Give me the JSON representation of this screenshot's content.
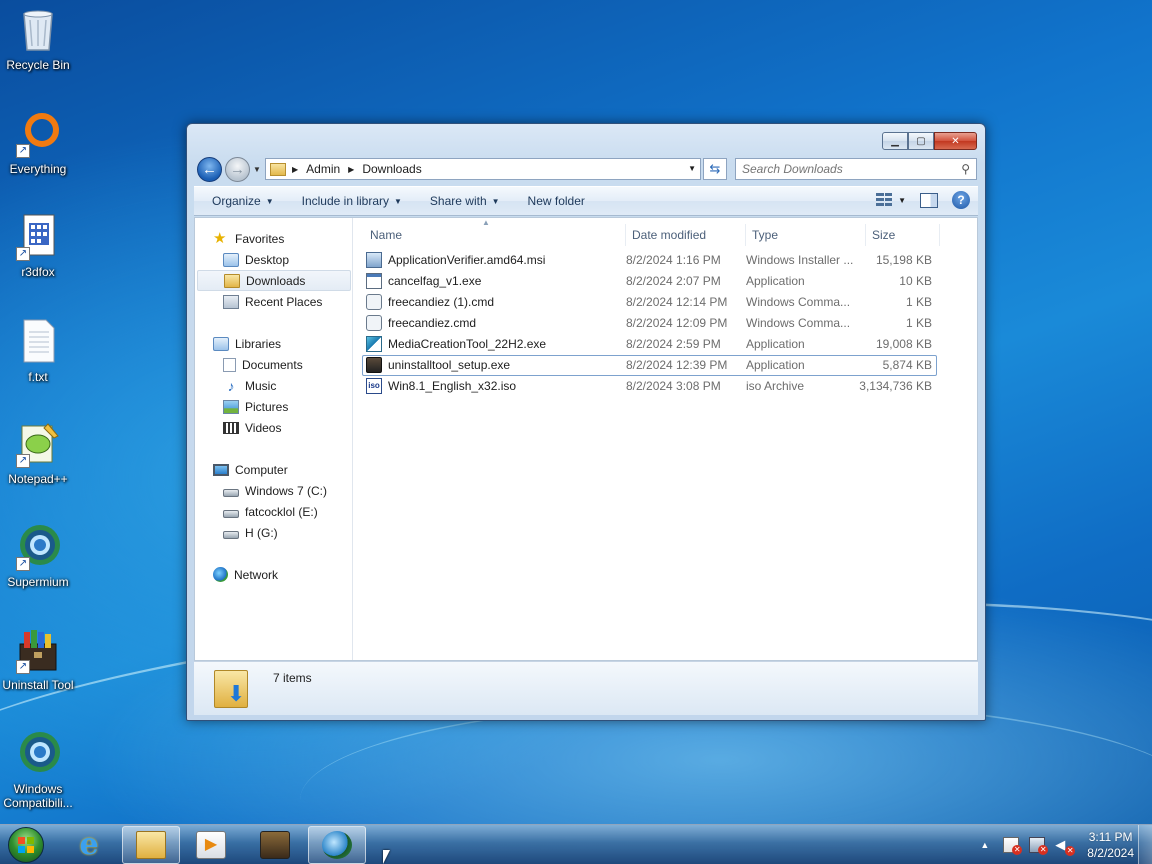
{
  "desktop": {
    "icons": [
      {
        "label": "Recycle Bin",
        "icon": "recycle-bin-icon"
      },
      {
        "label": "Everything",
        "icon": "everything-icon"
      },
      {
        "label": "r3dfox",
        "icon": "r3dfox-icon"
      },
      {
        "label": "f.txt",
        "icon": "text-file-icon"
      },
      {
        "label": "Notepad++",
        "icon": "notepad-plus-plus-icon"
      },
      {
        "label": "Supermium",
        "icon": "supermium-icon"
      },
      {
        "label": "Uninstall Tool",
        "icon": "uninstall-tool-icon"
      },
      {
        "label": "Windows Compatibili...",
        "icon": "windows-compatibility-icon"
      }
    ]
  },
  "window": {
    "address": {
      "crumbs": [
        "Admin",
        "Downloads"
      ]
    },
    "search": {
      "placeholder": "Search Downloads"
    },
    "toolbar": {
      "organize": "Organize",
      "include_in_library": "Include in library",
      "share_with": "Share with",
      "new_folder": "New folder"
    },
    "nav": {
      "favorites": "Favorites",
      "desktop": "Desktop",
      "downloads": "Downloads",
      "recent_places": "Recent Places",
      "libraries": "Libraries",
      "documents": "Documents",
      "music": "Music",
      "pictures": "Pictures",
      "videos": "Videos",
      "computer": "Computer",
      "drive_c": "Windows 7 (C:)",
      "drive_e": "fatcocklol (E:)",
      "drive_g": "H (G:)",
      "network": "Network",
      "selected": "Downloads"
    },
    "columns": {
      "name": "Name",
      "date_modified": "Date modified",
      "type": "Type",
      "size": "Size"
    },
    "files": [
      {
        "name": "ApplicationVerifier.amd64.msi",
        "date": "8/2/2024 1:16 PM",
        "type": "Windows Installer ...",
        "size": "15,198 KB",
        "icon": "msi-icon"
      },
      {
        "name": "cancelfag_v1.exe",
        "date": "8/2/2024 2:07 PM",
        "type": "Application",
        "size": "10 KB",
        "icon": "exe-icon"
      },
      {
        "name": "freecandiez (1).cmd",
        "date": "8/2/2024 12:14 PM",
        "type": "Windows Comma...",
        "size": "1 KB",
        "icon": "cmd-icon"
      },
      {
        "name": "freecandiez.cmd",
        "date": "8/2/2024 12:09 PM",
        "type": "Windows Comma...",
        "size": "1 KB",
        "icon": "cmd-icon"
      },
      {
        "name": "MediaCreationTool_22H2.exe",
        "date": "8/2/2024 2:59 PM",
        "type": "Application",
        "size": "19,008 KB",
        "icon": "media-creation-tool-icon"
      },
      {
        "name": "uninstalltool_setup.exe",
        "date": "8/2/2024 12:39 PM",
        "type": "Application",
        "size": "5,874 KB",
        "icon": "installer-box-icon"
      },
      {
        "name": "Win8.1_English_x32.iso",
        "date": "8/2/2024 3:08 PM",
        "type": "iso Archive",
        "size": "3,134,736 KB",
        "icon": "iso-icon"
      }
    ],
    "selected_file": "uninstalltool_setup.exe",
    "details": {
      "item_count": "7 items"
    }
  },
  "taskbar": {
    "apps": [
      "internet-explorer-icon",
      "windows-explorer-icon",
      "media-player-icon",
      "uninstall-tool-icon",
      "supermium-icon"
    ],
    "clock": {
      "time": "3:11 PM",
      "date": "8/2/2024"
    }
  }
}
